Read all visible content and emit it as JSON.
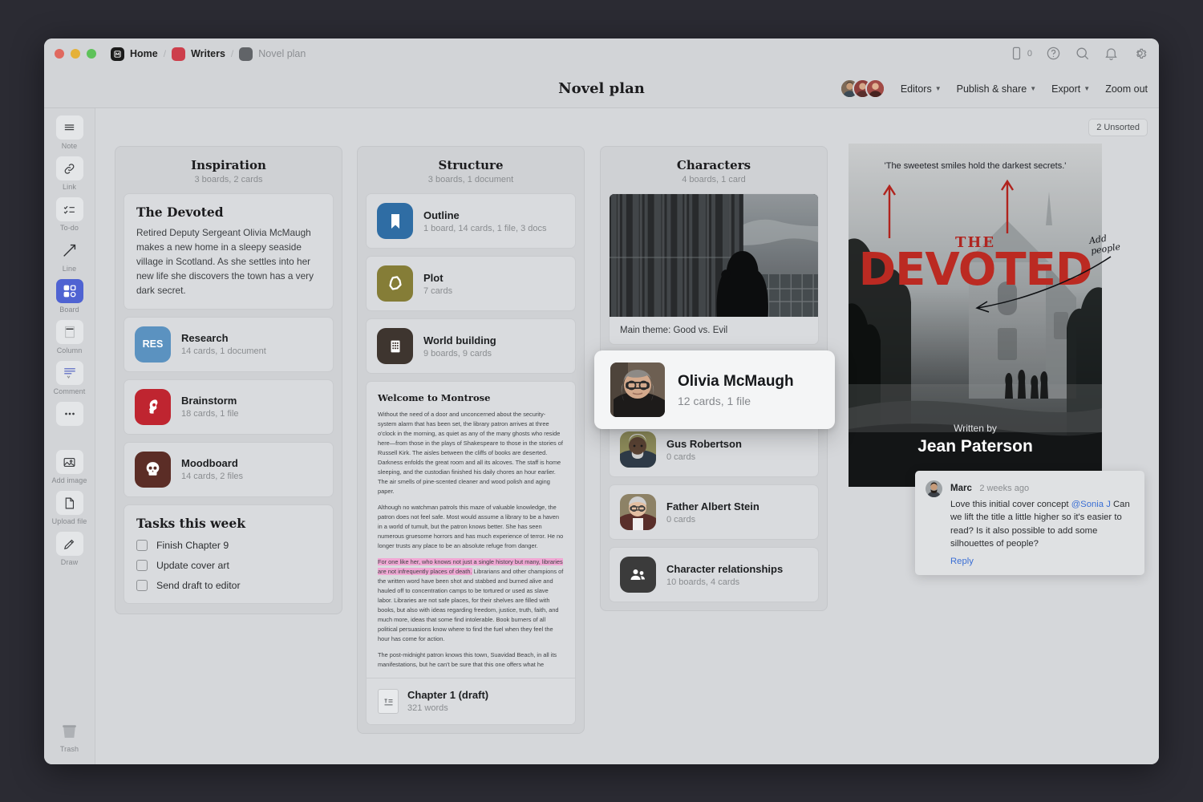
{
  "titlebar": {
    "breadcrumbs": [
      {
        "label": "Home",
        "icon": "milanote-logo-icon",
        "color": "#1b1b1b",
        "muted": false
      },
      {
        "label": "Writers",
        "icon": "board-square-icon",
        "color": "#cd3f4c",
        "muted": false
      },
      {
        "label": "Novel plan",
        "icon": "board-square-icon",
        "color": "#616468",
        "muted": true
      }
    ],
    "separator": "/",
    "right_icons": [
      {
        "name": "mobile-icon",
        "badge": "0"
      },
      {
        "name": "help-icon",
        "badge": ""
      },
      {
        "name": "search-icon",
        "badge": ""
      },
      {
        "name": "notifications-bell-icon",
        "badge": ""
      },
      {
        "name": "settings-gear-icon",
        "badge": ""
      }
    ]
  },
  "header": {
    "title": "Novel plan",
    "buttons": [
      {
        "label": "Editors",
        "caret": true
      },
      {
        "label": "Publish & share",
        "caret": true
      },
      {
        "label": "Export",
        "caret": true
      },
      {
        "label": "Zoom out",
        "caret": false
      }
    ]
  },
  "toolbar": {
    "tools": [
      {
        "label": "Note",
        "icon": "note-lines-icon",
        "active": false,
        "boxed": true
      },
      {
        "label": "Link",
        "icon": "link-chain-icon",
        "active": false,
        "boxed": true
      },
      {
        "label": "To-do",
        "icon": "todo-checklist-icon",
        "active": false,
        "boxed": true
      },
      {
        "label": "Line",
        "icon": "line-arrow-icon",
        "active": false,
        "boxed": false
      },
      {
        "label": "Board",
        "icon": "board-grid-icon",
        "active": true,
        "boxed": true
      },
      {
        "label": "Column",
        "icon": "column-icon",
        "active": false,
        "boxed": true
      },
      {
        "label": "Comment",
        "icon": "comment-bubble-icon",
        "active": false,
        "boxed": true
      },
      {
        "label": "",
        "icon": "more-dots-icon",
        "active": false,
        "boxed": true
      },
      {
        "label": "Add image",
        "icon": "add-image-icon",
        "active": false,
        "boxed": true
      },
      {
        "label": "Upload file",
        "icon": "upload-file-icon",
        "active": false,
        "boxed": true
      },
      {
        "label": "Draw",
        "icon": "draw-pencil-icon",
        "active": false,
        "boxed": true
      }
    ],
    "trash": {
      "label": "Trash",
      "icon": "trash-can-icon"
    }
  },
  "canvas": {
    "unsorted_badge": "2 Unsorted"
  },
  "columns": {
    "inspiration": {
      "title": "Inspiration",
      "subtitle": "3 boards, 2 cards",
      "note": {
        "heading": "The Devoted",
        "body": "Retired Deputy Sergeant Olivia McMaugh makes a new home in a sleepy seaside village in Scotland. As she settles into her new life she discovers the town has a very dark secret."
      },
      "items": [
        {
          "title": "Research",
          "subtitle": "14 cards, 1 document",
          "icon": "research-initials-icon",
          "glyph": "RES",
          "color": "#5b92c0"
        },
        {
          "title": "Brainstorm",
          "subtitle": "18 cards, 1 file",
          "icon": "brainstorm-head-icon",
          "glyph": "",
          "color": "#bf2530"
        },
        {
          "title": "Moodboard",
          "subtitle": "14 cards, 2 files",
          "icon": "moodboard-skull-icon",
          "glyph": "",
          "color": "#5b2d26"
        }
      ],
      "tasks": {
        "heading": "Tasks this week",
        "items": [
          {
            "label": "Finish Chapter 9",
            "checked": false
          },
          {
            "label": "Update cover art",
            "checked": false
          },
          {
            "label": "Send draft to editor",
            "checked": false
          }
        ]
      }
    },
    "structure": {
      "title": "Structure",
      "subtitle": "3 boards, 1 document",
      "items": [
        {
          "title": "Outline",
          "subtitle": "1 board, 14 cards, 1 file, 3 docs",
          "icon": "bookmark-icon",
          "color": "#2f6da4"
        },
        {
          "title": "Plot",
          "subtitle": "7 cards",
          "icon": "plot-blob-icon",
          "color": "#857d37"
        },
        {
          "title": "World building",
          "subtitle": "9 boards, 9 cards",
          "icon": "building-icon",
          "color": "#3e352f"
        }
      ],
      "document": {
        "heading": "Welcome to Montrose",
        "paragraphs": [
          {
            "text": "Without the need of a door and unconcerned about the security-system alarm that has been set, the library patron arrives at three o'clock in the morning, as quiet as any of the many ghosts who reside here—from those in the plays of Shakespeare to those in the stories of Russell Kirk. The aisles between the cliffs of books are deserted. Darkness enfolds the great room and all its alcoves. The staff is home sleeping, and the custodian finished his daily chores an hour earlier. The air smells of pine-scented cleaner and wood polish and aging paper.",
            "highlight": ""
          },
          {
            "text": "Although no watchman patrols this maze of valuable knowledge, the patron does not feel safe. Most would assume a library to be a haven in a world of tumult, but the patron knows better. She has seen numerous gruesome horrors and has much experience of terror. He no longer trusts any place to be an absolute refuge from danger.",
            "highlight": ""
          },
          {
            "text": " Librarians and other champions of the written word have been shot and stabbed and burned alive and hauled off to concentration camps to be tortured or used as slave labor. Libraries are not safe places, for their shelves are filled with books, but also with ideas regarding freedom, justice, truth, faith, and much more, ideas that some find intolerable. Book burners of all political persuasions know where to find the fuel when they feel the hour has come for action.",
            "highlight": "For one like her, who knows not just a single history but many, libraries are not infrequently places of death."
          },
          {
            "text": "The post-midnight patron knows this town, Suavidad Beach, in all its manifestations, but he can't be sure that this one offers what he",
            "highlight": ""
          }
        ],
        "footer": {
          "title": "Chapter 1 (draft)",
          "subtitle": "321 words",
          "icon": "text-document-icon"
        }
      }
    },
    "characters": {
      "title": "Characters",
      "subtitle": "4 boards, 1 card",
      "photo_caption": "Main theme: Good vs. Evil",
      "photo_alt": "silhouette-at-window-photo",
      "items": [
        {
          "title": "Gus Robertson",
          "subtitle": "0 cards",
          "icon": "avatar-photo-icon",
          "color": "#7c7a4e"
        },
        {
          "title": "Father Albert Stein",
          "subtitle": "0 cards",
          "icon": "avatar-photo-icon",
          "color": "#6b5f49"
        },
        {
          "title": "Character relationships",
          "subtitle": "10 boards, 4 cards",
          "icon": "people-group-icon",
          "color": "#3b3b3b"
        }
      ]
    }
  },
  "dragged_card": {
    "title": "Olivia McMaugh",
    "subtitle": "12 cards, 1 file",
    "icon": "avatar-photo-icon"
  },
  "book_cover": {
    "quote": "'The sweetest smiles hold the darkest secrets.'",
    "title_small": "THE",
    "title_main": "DEVOTED",
    "written_by": "Written by",
    "author": "Jean Paterson",
    "annotation": "Add\npeople",
    "title_color": "#bb2a22"
  },
  "comment": {
    "author": "Marc",
    "time": "2 weeks ago",
    "text_before": "Love this initial cover concept ",
    "mention": "@Sonia J",
    "text_after": " Can we lift the title a little higher so it's easier to read? Is it also possible to add some silhouettes of people?",
    "reply_label": "Reply",
    "mention_color": "#3b6fd4"
  }
}
